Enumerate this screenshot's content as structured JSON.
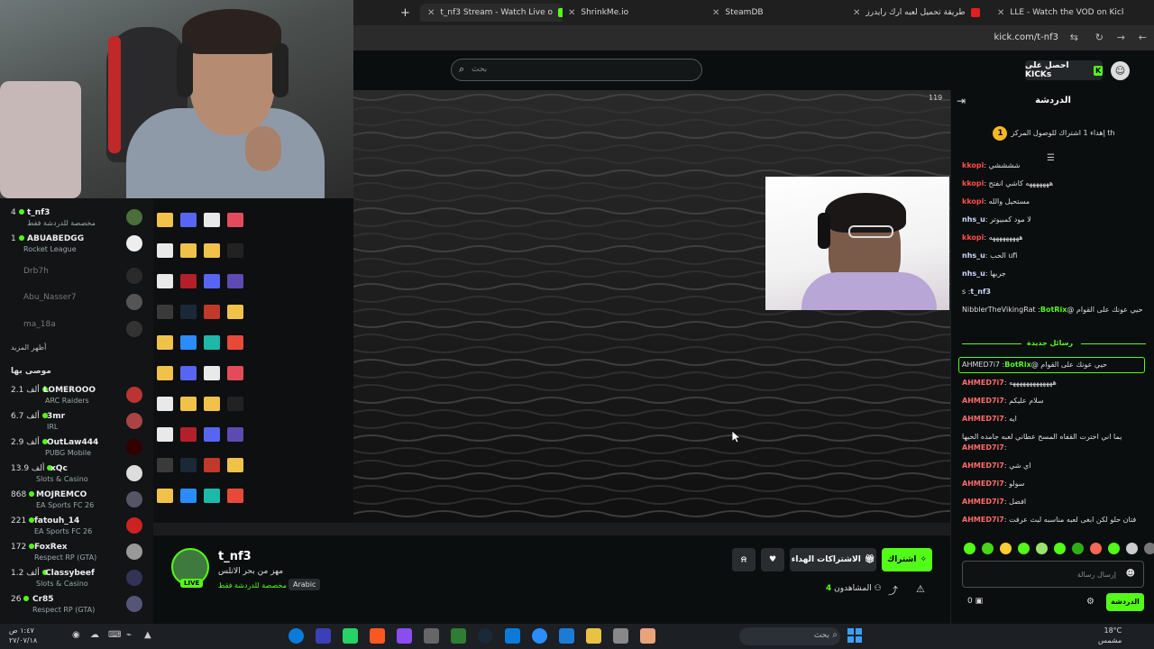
{
  "browser": {
    "tabs": [
      {
        "label": "LLE - Watch the VOD on Kick",
        "active": false
      },
      {
        "label": "طريقة تحميل لعبه ارك رايدرز",
        "active": false
      },
      {
        "label": "SteamDB",
        "active": false
      },
      {
        "label": "ShrinkMe.io",
        "active": false
      },
      {
        "label": "t_nf3 Stream - Watch Live o",
        "active": true
      }
    ],
    "new_tab": "+",
    "url": "kick.com/t-nf3"
  },
  "header": {
    "search_placeholder": "بحث",
    "get_kicks_label": "احصل على KICKs"
  },
  "sidebar": {
    "following": [
      {
        "name": "t_nf3",
        "sub": "مخصصة للدردشة فقط",
        "count": "4",
        "live": true
      },
      {
        "name": "ABUABEDGG",
        "sub": "Rocket League",
        "count": "1",
        "live": true
      },
      {
        "name": "Drb7h",
        "sub": "",
        "count": "",
        "live": false
      },
      {
        "name": "Abu_Nasser7",
        "sub": "",
        "count": "",
        "live": false
      },
      {
        "name": "ma_18a",
        "sub": "",
        "count": "",
        "live": false
      }
    ],
    "show_more": "أظهر المزيد",
    "recommended_heading": "موصى بها",
    "recommended": [
      {
        "name": "LOMEROOO",
        "sub": "ARC Raiders",
        "count": "2.1 ألف"
      },
      {
        "name": "3mr",
        "sub": "IRL",
        "count": "6.7 ألف"
      },
      {
        "name": "OutLaw444",
        "sub": "PUBG Mobile",
        "count": "2.9 ألف"
      },
      {
        "name": "xQc",
        "sub": "Slots & Casino",
        "count": "13.9 ألف"
      },
      {
        "name": "MOJREMCO",
        "sub": "EA Sports FC 26",
        "count": "868"
      },
      {
        "name": "fatouh_14",
        "sub": "EA Sports FC 26",
        "count": "221"
      },
      {
        "name": "FoxRex",
        "sub": "Respect RP (GTA)",
        "count": "172"
      },
      {
        "name": "Classybeef",
        "sub": "Slots & Casino",
        "count": "1.2 ألف"
      },
      {
        "name": "Cr85",
        "sub": "Respect RP (GTA)",
        "count": "26"
      }
    ]
  },
  "stream": {
    "viewer_badge": "119",
    "name": "t_nf3",
    "title": "مهز من بحر الاتلس",
    "category": "مخصصة للدردشة فقط",
    "language": "Arabic",
    "live_label": "LIVE",
    "subscribe_label": "اشتراك",
    "gift_label": "الاشتراكات الهداء",
    "viewers_label": "المشاهدون",
    "viewers_count": "4"
  },
  "chat": {
    "title": "الدردشة",
    "pinned_rank": "1",
    "pinned_text": "إهداء 1 اشتراك للوصول المركز th",
    "messages": [
      {
        "user": "kkopi",
        "text": "ششششي",
        "color": "#ff4d4d"
      },
      {
        "user": "kkopi",
        "text": "هههههههه كاشي انفتح",
        "color": "#ff4d4d"
      },
      {
        "user": "kkopi",
        "text": "مستحيل والله",
        "color": "#ff4d4d"
      },
      {
        "user": "nhs_u",
        "text": "لا مود كمبيوتر",
        "color": "#cfd8ff"
      },
      {
        "user": "kkopi",
        "text": "هههههههههه",
        "color": "#ff4d4d"
      },
      {
        "user": "nhs_u",
        "text": "ufi الحب",
        "color": "#cfd8ff"
      },
      {
        "user": "nhs_u",
        "text": "جربها",
        "color": "#cfd8ff"
      },
      {
        "user": "t_nf3",
        "text": "s",
        "color": "#cfd8ff"
      },
      {
        "user": "BotRix",
        "text": "حيي عونك على القوام @NibblerTheVikingRat",
        "color": "#53fc18"
      }
    ],
    "new_messages_label": "رسائل جديدة",
    "messages_after": [
      {
        "user": "BotRix",
        "text": "حيي عونك على القوام @AHMED7i7",
        "color": "#53fc18"
      },
      {
        "user": "AHMED7i7",
        "text": "هههههههههههههه",
        "color": "#ff6b6b"
      },
      {
        "user": "AHMED7i7",
        "text": "سلام عليكم",
        "color": "#ff6b6b"
      },
      {
        "user": "AHMED7i7",
        "text": "ايه",
        "color": "#ff6b6b"
      },
      {
        "user": "AHMED7i7",
        "text": "يما اني اخترت القفاه المسح عطاني لعبه جامده الحيها",
        "color": "#ff6b6b"
      },
      {
        "user": "AHMED7i7",
        "text": "اي شي",
        "color": "#ff6b6b"
      },
      {
        "user": "AHMED7i7",
        "text": "سولو",
        "color": "#ff6b6b"
      },
      {
        "user": "AHMED7i7",
        "text": "افضل",
        "color": "#ff6b6b"
      },
      {
        "user": "AHMED7i7",
        "text": "فتان حلو لكن ابغى لعبه مناسبه لبث عرفت",
        "color": "#ff6b6b"
      }
    ],
    "input_placeholder": "إرسال رسالة",
    "send_label": "الدردشة",
    "points": "0"
  },
  "taskbar": {
    "search_label": "بحث",
    "clock_time": "١:٤٧ ص",
    "clock_date": "٢٧/٠٧/١٨",
    "weather_temp": "18°C",
    "weather_desc": "مشمس"
  },
  "colors": {
    "kick_green": "#53fc18",
    "bg": "#0b0e0f"
  }
}
